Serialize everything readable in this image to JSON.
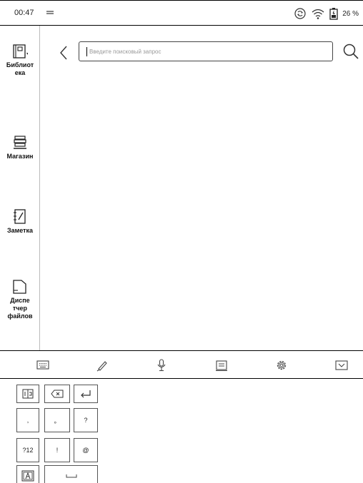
{
  "status": {
    "time": "00:47",
    "battery": "26 %",
    "icons": [
      "keyboard-indicator-icon",
      "sync-icon",
      "wifi-icon",
      "battery-icon"
    ]
  },
  "sidebar": {
    "items": [
      {
        "label": "Библиот\nека",
        "icon": "library-icon"
      },
      {
        "label": "Магазин",
        "icon": "store-icon"
      },
      {
        "label": "Заметка",
        "icon": "note-icon"
      },
      {
        "label": "Диспе\nтчер\nфайлов",
        "icon": "file-manager-icon"
      }
    ]
  },
  "search": {
    "placeholder": "Введите поисковый запрос",
    "value": ""
  },
  "toolbar": {
    "icons": [
      "keyboard-icon",
      "handwriting-pen-icon",
      "microphone-icon",
      "clipboard-icon",
      "settings-gear-icon",
      "hide-keyboard-icon"
    ]
  },
  "keyboard": {
    "keys": {
      "punct_comma": ",",
      "punct_period": "。",
      "question": "?",
      "numeric": "?12",
      "exclaim": "!",
      "at": "@"
    }
  }
}
